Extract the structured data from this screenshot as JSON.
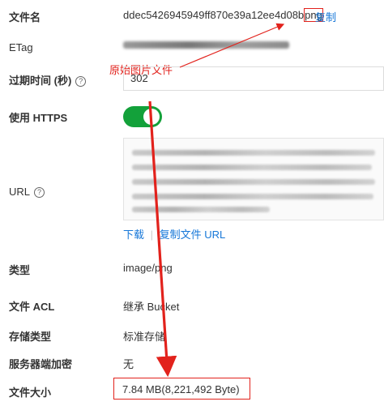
{
  "fields": {
    "filename": {
      "label": "文件名",
      "value_main": "ddec5426945949ff870e39a12ee4d08b",
      "value_ext": "png",
      "copy": "复制"
    },
    "etag": {
      "label": "ETag"
    },
    "expire": {
      "label": "过期时间 (秒)",
      "help": "?",
      "value": "302"
    },
    "https": {
      "label": "使用 HTTPS",
      "enabled": true
    },
    "url": {
      "label": "URL",
      "help": "?",
      "download": "下载",
      "copy_url": "复制文件 URL"
    },
    "type": {
      "label": "类型",
      "value": "image/png"
    },
    "acl": {
      "label": "文件 ACL",
      "value": "继承 Bucket"
    },
    "storage": {
      "label": "存储类型",
      "value": "标准存储"
    },
    "encryption": {
      "label": "服务器端加密",
      "value": "无"
    },
    "size": {
      "label": "文件大小",
      "value": "7.84 MB(8,221,492 Byte)"
    }
  },
  "annotation": {
    "text": "原始图片文件",
    "color": "#e2221c"
  }
}
